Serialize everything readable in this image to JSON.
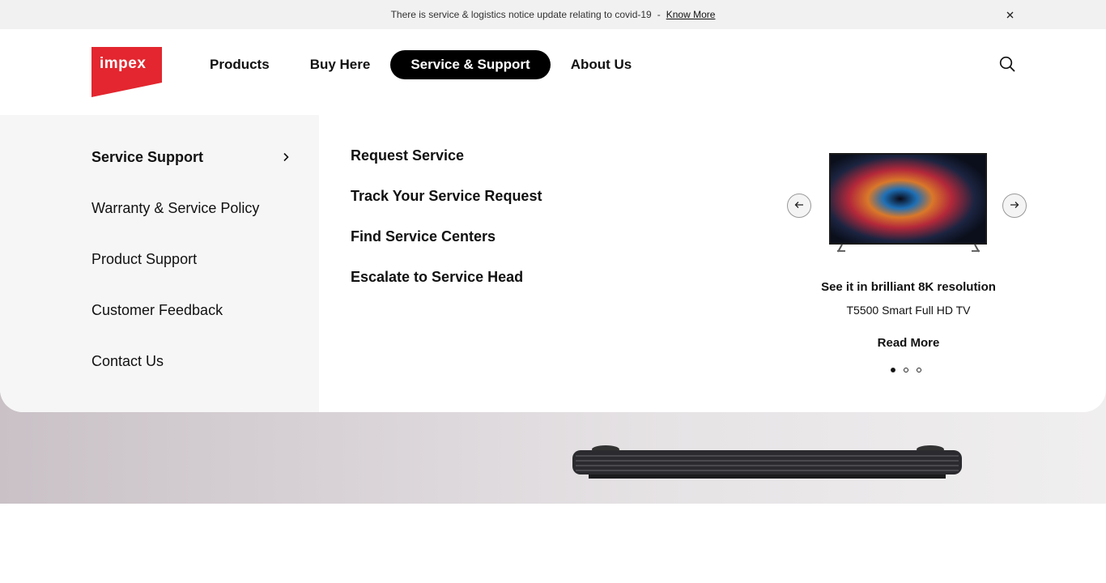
{
  "notice": {
    "text": "There is service & logistics notice update relating to covid-19",
    "separator": "-",
    "link": "Know More"
  },
  "header": {
    "logo_text": "impex",
    "nav": [
      {
        "label": "Products"
      },
      {
        "label": "Buy Here"
      },
      {
        "label": "Service & Support",
        "active": true
      },
      {
        "label": "About Us"
      }
    ]
  },
  "menu": {
    "left_items": [
      {
        "label": "Service Support",
        "active": true
      },
      {
        "label": "Warranty & Service Policy"
      },
      {
        "label": "Product Support"
      },
      {
        "label": "Customer Feedback"
      },
      {
        "label": "Contact Us"
      }
    ],
    "sub_items": [
      {
        "label": "Request Service"
      },
      {
        "label": "Track Your Service Request"
      },
      {
        "label": "Find Service Centers"
      },
      {
        "label": "Escalate to Service Head"
      }
    ]
  },
  "promo": {
    "title": "See it in brilliant 8K resolution",
    "subtitle": "T5500 Smart Full HD TV",
    "link": "Read More",
    "slide_count": 3,
    "active_slide": 1
  },
  "colors": {
    "brand": "#e3262f",
    "active_nav_bg": "#000000",
    "menu_left_bg": "#f6f6f6",
    "notice_bg": "#f1f1f1"
  }
}
